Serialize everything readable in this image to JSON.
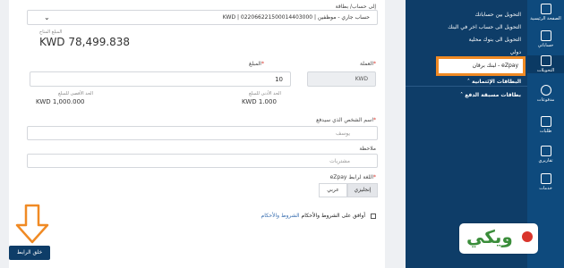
{
  "form": {
    "to_account_label": "إلى حساب/ بطاقة",
    "account_value": "حساب جاري - موظفين | 022066221500014403000 | KWD",
    "balance_label": "المبلغ المتاح",
    "balance_value": "KWD 78,499.838",
    "currency_label": "العملة",
    "currency_value": "KWD",
    "amount_label": "المبلغ",
    "amount_value": "10",
    "max_limit_label": "الحد الأقصى للمبلغ",
    "max_limit_value": "KWD 1,000.000",
    "min_limit_label": "الحد الأدنى للمبلغ",
    "min_limit_value": "KWD 1.000",
    "payer_name_label": "اسم الشخص الذي سيدفع",
    "payer_name_value": "يوسف",
    "note_label": "ملاحظة",
    "note_value": "مشتريات",
    "lang_label": "اللغة لرابط eZpay",
    "lang_english": "إنجليزي",
    "lang_arabic": "عربي",
    "terms_text": "أوافق على الشروط والأحكام",
    "terms_link": "الشروط والأحكام",
    "create_button": "خلق الرابط"
  },
  "menu": {
    "items": [
      "التحويل بين حساباتك",
      "التحويل الى حساب اخر في البنك",
      "التحويل الى بنوك محلية",
      "دولي",
      "eZpay - لبنك برقان"
    ],
    "section_1": "البطاقات الإئتمانية",
    "section_2": "بطاقات مسبقة الدفع"
  },
  "rail": {
    "items": [
      "الصفحة الرئيسية",
      "حساباتي",
      "التحويلات",
      "مدفوعات",
      "طلبات",
      "تقاريري",
      "خدمات"
    ]
  },
  "logo_text": "ويكي"
}
